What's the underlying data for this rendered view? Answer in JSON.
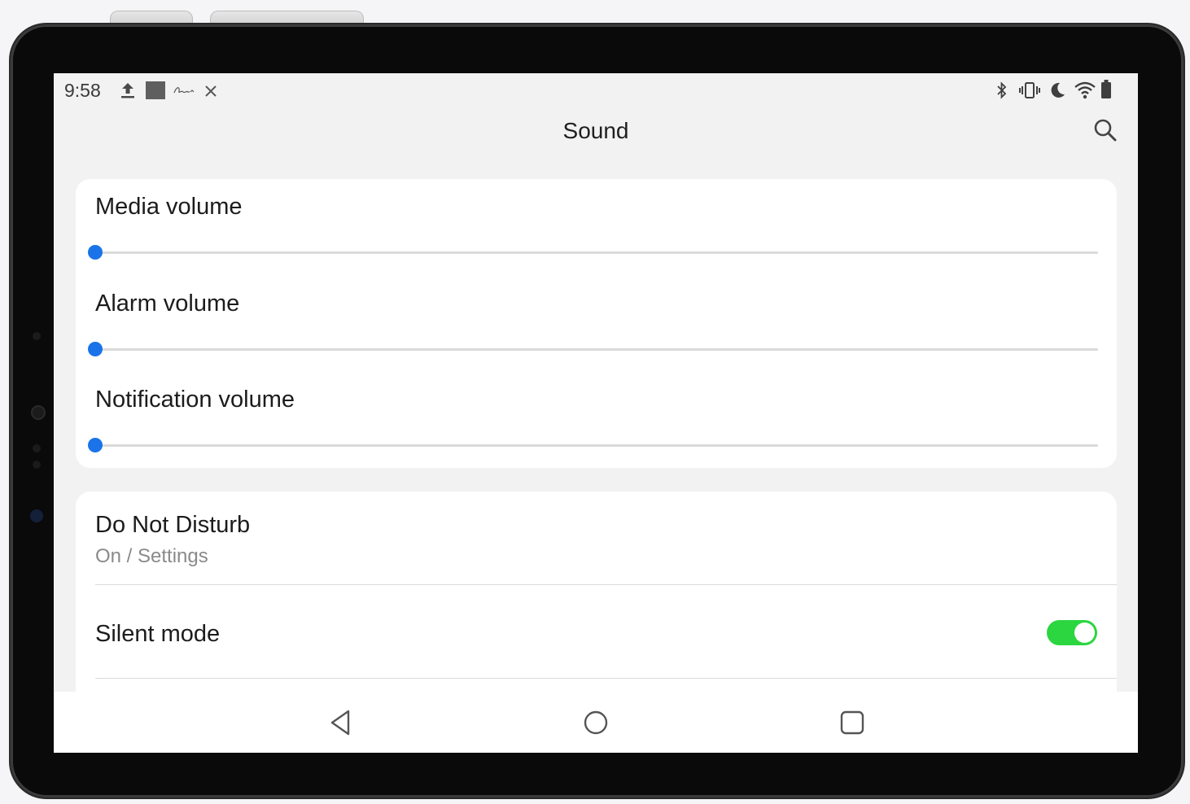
{
  "status_bar": {
    "time": "9:58",
    "left_icons": [
      "upload-icon",
      "image-thumbnail-icon",
      "signature-icon",
      "leaf-app-icon"
    ],
    "right_icons": [
      "bluetooth-icon",
      "vibrate-icon",
      "do-not-disturb-moon-icon",
      "wifi-icon",
      "battery-icon"
    ]
  },
  "appbar": {
    "title": "Sound",
    "search_icon": "search-icon"
  },
  "volumes": [
    {
      "label": "Media volume",
      "level": 0
    },
    {
      "label": "Alarm volume",
      "level": 0
    },
    {
      "label": "Notification volume",
      "level": 0
    }
  ],
  "settings": {
    "dnd": {
      "title": "Do Not Disturb",
      "subtitle": "On / Settings"
    },
    "silent_mode": {
      "title": "Silent mode",
      "enabled": true
    }
  },
  "nav": {
    "back_icon": "back-triangle-icon",
    "home_icon": "home-circle-icon",
    "recents_icon": "recents-square-icon"
  },
  "colors": {
    "accent": "#1a73e8",
    "toggle_on": "#2bd641",
    "background": "#f2f2f2",
    "card": "#ffffff"
  }
}
